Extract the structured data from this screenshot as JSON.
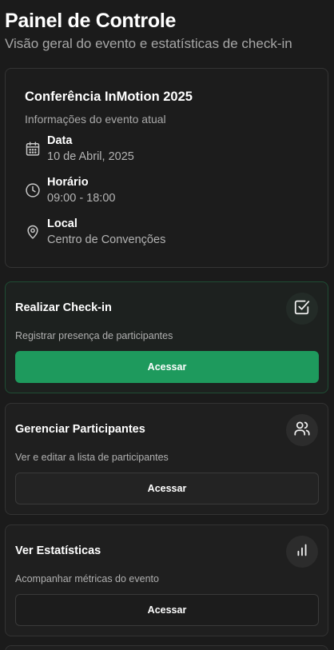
{
  "header": {
    "title": "Painel de Controle",
    "subtitle": "Visão geral do evento e estatísticas de check-in"
  },
  "event": {
    "title": "Conferência InMotion 2025",
    "description": "Informações do evento atual",
    "date_label": "Data",
    "date_value": "10 de Abril, 2025",
    "time_label": "Horário",
    "time_value": "09:00 - 18:00",
    "location_label": "Local",
    "location_value": "Centro de Convenções"
  },
  "actions": {
    "checkin": {
      "title": "Realizar Check-in",
      "description": "Registrar presença de participantes",
      "button": "Acessar",
      "icon": "check-square-icon"
    },
    "participants": {
      "title": "Gerenciar Participantes",
      "description": "Ver e editar a lista de participantes",
      "button": "Acessar",
      "icon": "users-icon"
    },
    "statistics": {
      "title": "Ver Estatísticas",
      "description": "Acompanhar métricas do evento",
      "button": "Acessar",
      "icon": "bar-chart-icon"
    }
  },
  "colors": {
    "background": "#1b1b1b",
    "accent": "#1e9a5d",
    "text_muted": "#a7a7a7"
  }
}
